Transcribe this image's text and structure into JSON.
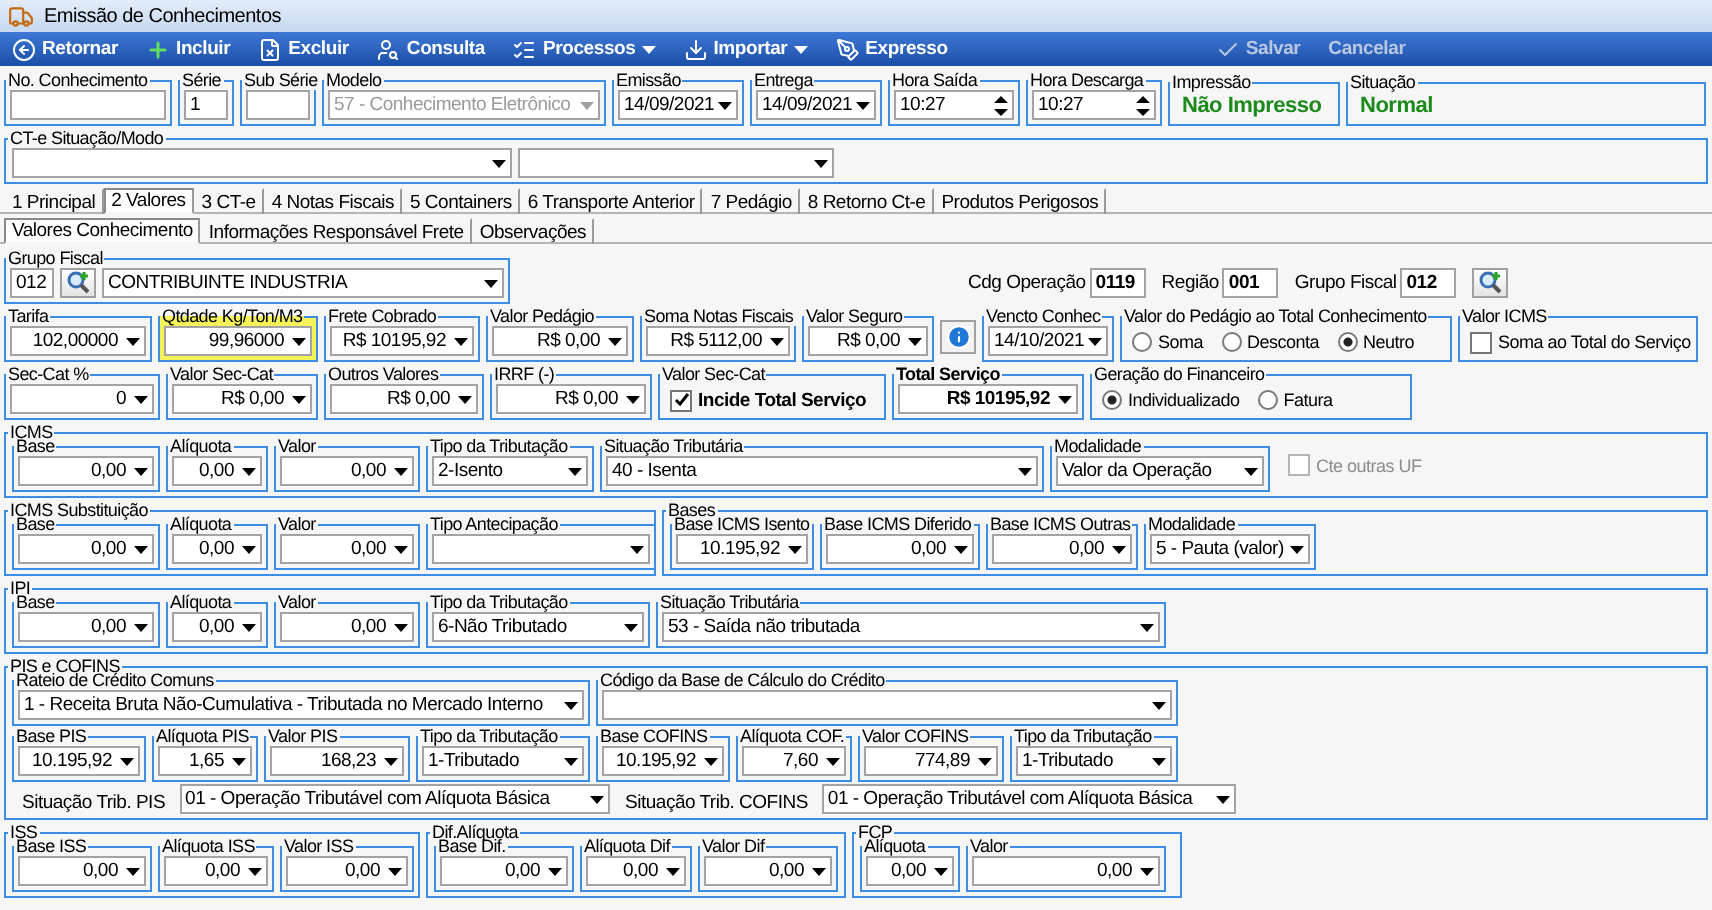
{
  "window": {
    "title": "Emissão de Conhecimentos"
  },
  "toolbar": {
    "left": [
      {
        "label": "Retornar",
        "menu": false,
        "disabled": false
      },
      {
        "label": "Incluir",
        "menu": false,
        "disabled": false
      },
      {
        "label": "Excluir",
        "menu": false,
        "disabled": false
      },
      {
        "label": "Consulta",
        "menu": false,
        "disabled": false
      },
      {
        "label": "Processos",
        "menu": true,
        "disabled": false
      },
      {
        "label": "Importar",
        "menu": true,
        "disabled": false
      },
      {
        "label": "Expresso",
        "menu": false,
        "disabled": false
      }
    ],
    "right": [
      {
        "label": "Salvar",
        "menu": false,
        "disabled": true
      },
      {
        "label": "Cancelar",
        "menu": false,
        "disabled": true
      }
    ]
  },
  "header": [
    {
      "kind": "text",
      "label": "No. Conhecimento"
    },
    {
      "kind": "text",
      "label": "Série",
      "value": "1"
    },
    {
      "kind": "text",
      "label": "Sub Série"
    },
    {
      "kind": "combo",
      "label": "Modelo",
      "value": "57 - Conhecimento Eletrônico",
      "disabled": true
    },
    {
      "kind": "combo",
      "label": "Emissão",
      "value": "14/09/2021",
      "disabled": false
    },
    {
      "kind": "combo",
      "label": "Entrega",
      "value": "14/09/2021",
      "disabled": false
    },
    {
      "kind": "time",
      "label": "Hora Saída",
      "value": "10:27"
    },
    {
      "kind": "time",
      "label": "Hora Descarga",
      "value": "10:27"
    },
    {
      "kind": "status",
      "label": "Impressão",
      "value": "Não Impresso"
    },
    {
      "kind": "status",
      "label": "Situação",
      "value": "Normal"
    }
  ],
  "cte_situacao": {
    "label": "CT-e Situação/Modo",
    "fields": [
      {
        "kind": "combo"
      },
      {
        "kind": "combo"
      }
    ]
  },
  "tabs": [
    {
      "label": "1 Principal",
      "selected": false
    },
    {
      "label": "2 Valores",
      "selected": true
    },
    {
      "label": "3 CT-e",
      "selected": false
    },
    {
      "label": "4 Notas Fiscais",
      "selected": false
    },
    {
      "label": "5 Containers",
      "selected": false
    },
    {
      "label": "6 Transporte Anterior",
      "selected": false
    },
    {
      "label": "7 Pedágio",
      "selected": false
    },
    {
      "label": "8 Retorno Ct-e",
      "selected": false
    },
    {
      "label": "Produtos Perigosos",
      "selected": false
    }
  ],
  "subtabs": [
    {
      "label": "Valores Conhecimento",
      "selected": true
    },
    {
      "label": "Informações Responsável Frete",
      "selected": false
    },
    {
      "label": "Observações",
      "selected": false
    }
  ],
  "grupo_fiscal": {
    "label": "Grupo Fiscal",
    "code": "012",
    "value": "CONTRIBUINTE INDUSTRIA"
  },
  "codes": [
    {
      "label": "Cdg Operação",
      "value": "0119"
    },
    {
      "label": "Região",
      "value": "001"
    },
    {
      "label": "Grupo Fiscal",
      "value": "012"
    }
  ],
  "values_row_1": [
    {
      "kind": "number",
      "label": "Tarifa",
      "value": "102,00000",
      "highlighted": false
    },
    {
      "kind": "number",
      "label": "Qtdade Kg/Ton/M3",
      "value": "99,96000",
      "highlighted": true
    },
    {
      "kind": "number",
      "label": "Frete Cobrado",
      "value": "R$ 10195,92",
      "highlighted": false
    },
    {
      "kind": "number",
      "label": "Valor Pedágio",
      "value": "R$ 0,00",
      "highlighted": false
    },
    {
      "kind": "number",
      "label": "Soma Notas Fiscais",
      "value": "R$ 5112,00",
      "highlighted": false
    },
    {
      "kind": "number",
      "label": "Valor Seguro",
      "value": "R$ 0,00",
      "highlighted": false
    },
    {
      "kind": "info"
    },
    {
      "kind": "combo",
      "label": "Vencto Conhec",
      "value": "14/10/2021"
    },
    {
      "kind": "radios",
      "label": "Valor do Pedágio ao Total Conhecimento",
      "options": [
        {
          "label": "Soma",
          "selected": false
        },
        {
          "label": "Desconta",
          "selected": false
        },
        {
          "label": "Neutro",
          "selected": true
        }
      ]
    },
    {
      "kind": "check",
      "label": "Valor ICMS",
      "text": "Soma ao Total do Serviço",
      "checked": false,
      "emphasis": false
    }
  ],
  "values_row_2": [
    {
      "kind": "number",
      "label": "Sec-Cat %",
      "value": "0"
    },
    {
      "kind": "number",
      "label": "Valor Sec-Cat",
      "value": "R$ 0,00"
    },
    {
      "kind": "number",
      "label": "Outros Valores",
      "value": "R$ 0,00"
    },
    {
      "kind": "number",
      "label": "IRRF (-)",
      "value": "R$ 0,00"
    },
    {
      "kind": "check",
      "label": "Valor Sec-Cat",
      "text": "Incide Total Serviço",
      "checked": true,
      "emphasis": true
    },
    {
      "kind": "total",
      "label": "Total Serviço",
      "value": "R$ 10195,92"
    },
    {
      "kind": "radios",
      "label": "Geração do Financeiro",
      "options": [
        {
          "label": "Individualizado",
          "selected": true
        },
        {
          "label": "Fatura",
          "selected": false
        }
      ]
    }
  ],
  "icms": {
    "label": "ICMS",
    "fields": [
      {
        "kind": "number",
        "label": "Base",
        "value": "0,00"
      },
      {
        "kind": "number",
        "label": "Alíquota",
        "value": "0,00"
      },
      {
        "kind": "number",
        "label": "Valor",
        "value": "0,00"
      },
      {
        "kind": "combo",
        "label": "Tipo da Tributação",
        "value": "2-Isento"
      },
      {
        "kind": "combo",
        "label": "Situação Tributária",
        "value": "40 - Isenta"
      },
      {
        "kind": "combo",
        "label": "Modalidade",
        "value": "Valor da Operação"
      },
      {
        "kind": "loosecheck",
        "text": "Cte outras UF",
        "checked": false,
        "disabled": true
      }
    ]
  },
  "icms_st": {
    "label": "ICMS Substituição",
    "fields": [
      {
        "kind": "number",
        "label": "Base",
        "value": "0,00"
      },
      {
        "kind": "number",
        "label": "Alíquota",
        "value": "0,00"
      },
      {
        "kind": "number",
        "label": "Valor",
        "value": "0,00"
      },
      {
        "kind": "combo",
        "label": "Tipo Antecipação"
      }
    ]
  },
  "bases": {
    "label": "Bases",
    "fields": [
      {
        "kind": "number",
        "label": "Base ICMS Isento",
        "value": "10.195,92"
      },
      {
        "kind": "number",
        "label": "Base ICMS Diferido",
        "value": "0,00"
      },
      {
        "kind": "number",
        "label": "Base ICMS Outras",
        "value": "0,00"
      },
      {
        "kind": "combo",
        "label": "Modalidade",
        "value": "5 - Pauta (valor)"
      }
    ]
  },
  "ipi": {
    "label": "IPI",
    "fields": [
      {
        "kind": "number",
        "label": "Base",
        "value": "0,00"
      },
      {
        "kind": "number",
        "label": "Alíquota",
        "value": "0,00"
      },
      {
        "kind": "number",
        "label": "Valor",
        "value": "0,00"
      },
      {
        "kind": "combo",
        "label": "Tipo da Tributação",
        "value": "6-Não Tributado"
      },
      {
        "kind": "combo",
        "label": "Situação Tributária",
        "value": "53 - Saída não tributada"
      }
    ]
  },
  "pis_cofins": {
    "label": "PIS e COFINS",
    "credito": [
      {
        "kind": "combo",
        "label": "Rateio de Crédito Comuns",
        "value": "1 - Receita Bruta Não-Cumulativa - Tributada no Mercado Interno"
      },
      {
        "kind": "combo",
        "label": "Código da Base de Cálculo do Crédito"
      }
    ],
    "valores": [
      {
        "kind": "number",
        "label": "Base PIS",
        "value": "10.195,92"
      },
      {
        "kind": "number",
        "label": "Alíquota PIS",
        "value": "1,65"
      },
      {
        "kind": "number",
        "label": "Valor PIS",
        "value": "168,23"
      },
      {
        "kind": "combo",
        "label": "Tipo da Tributação",
        "value": "1-Tributado"
      },
      {
        "kind": "number",
        "label": "Base COFINS",
        "value": "10.195,92"
      },
      {
        "kind": "number",
        "label": "Alíquota COF.",
        "value": "7,60"
      },
      {
        "kind": "number",
        "label": "Valor COFINS",
        "value": "774,89"
      },
      {
        "kind": "combo",
        "label": "Tipo da Tributação",
        "value": "1-Tributado"
      }
    ],
    "situacao": [
      {
        "kind": "labeled_combo",
        "label": "Situação Trib. PIS",
        "value": "01 - Operação Tributável com Alíquota Básica"
      },
      {
        "kind": "labeled_combo",
        "label": "Situação Trib. COFINS",
        "value": "01 - Operação Tributável com Alíquota Básica"
      }
    ]
  },
  "iss": {
    "label": "ISS",
    "fields": [
      {
        "kind": "number",
        "label": "Base ISS",
        "value": "0,00"
      },
      {
        "kind": "number",
        "label": "Alíquota ISS",
        "value": "0,00"
      },
      {
        "kind": "number",
        "label": "Valor ISS",
        "value": "0,00"
      }
    ]
  },
  "dif_aliquota": {
    "label": "Dif.Alíquota",
    "fields": [
      {
        "kind": "number",
        "label": "Base Dif.",
        "value": "0,00"
      },
      {
        "kind": "number",
        "label": "Alíquota Dif",
        "value": "0,00"
      },
      {
        "kind": "number",
        "label": "Valor Dif",
        "value": "0,00"
      }
    ]
  },
  "fcp": {
    "label": "FCP",
    "fields": [
      {
        "kind": "number",
        "label": "Alíquota",
        "value": "0,00"
      },
      {
        "kind": "number",
        "label": "Valor",
        "value": "0,00"
      }
    ]
  }
}
